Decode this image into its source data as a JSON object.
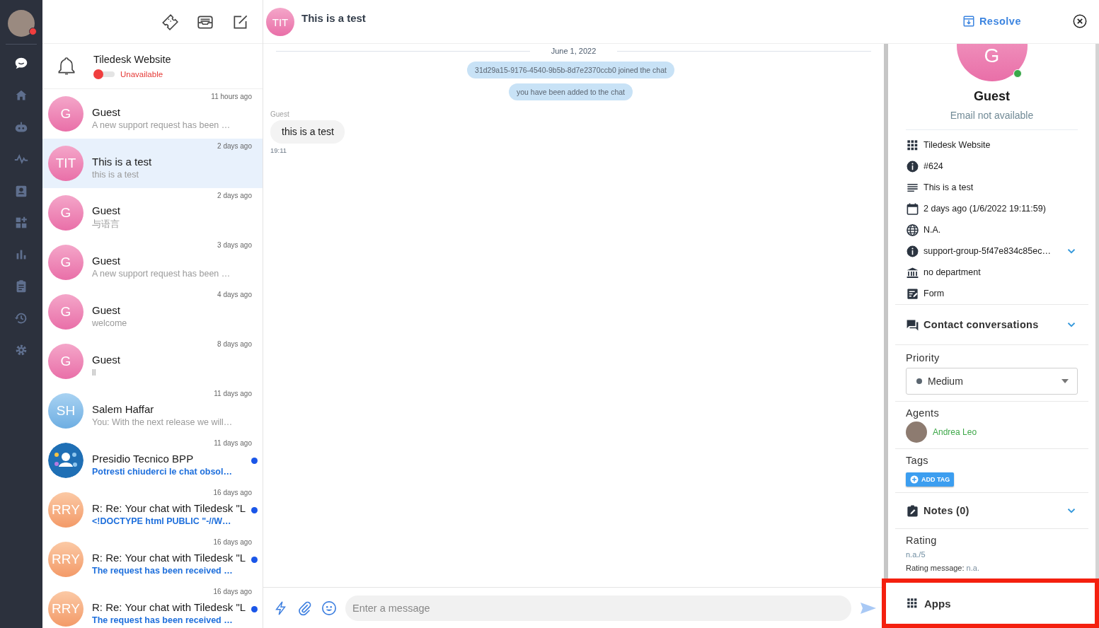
{
  "nav": {
    "items": [
      {
        "kind": "chat",
        "selected": true
      },
      {
        "kind": "home",
        "selected": false
      },
      {
        "kind": "bot",
        "selected": false
      },
      {
        "kind": "activity",
        "selected": false
      },
      {
        "kind": "contacts",
        "selected": false
      },
      {
        "kind": "widgets",
        "selected": false
      },
      {
        "kind": "analytics",
        "selected": false
      },
      {
        "kind": "clipboard",
        "selected": false
      },
      {
        "kind": "history",
        "selected": false
      },
      {
        "kind": "settings",
        "selected": false
      }
    ]
  },
  "availability": {
    "project": "Tiledesk Website",
    "status": "Unavailable",
    "on": false
  },
  "conversations": [
    {
      "kind": "pink",
      "initials": "G",
      "time": "11 hours ago",
      "title": "Guest",
      "preview": "A new support request has been …",
      "unread": false,
      "selected": false
    },
    {
      "kind": "pink",
      "initials": "TIT",
      "time": "2 days ago",
      "title": "This is a test",
      "preview": "this is a test",
      "unread": false,
      "selected": true
    },
    {
      "kind": "pink",
      "initials": "G",
      "time": "2 days ago",
      "title": "Guest",
      "preview": "与语言",
      "unread": false,
      "selected": false
    },
    {
      "kind": "pink",
      "initials": "G",
      "time": "3 days ago",
      "title": "Guest",
      "preview": "A new support request has been …",
      "unread": false,
      "selected": false
    },
    {
      "kind": "pink",
      "initials": "G",
      "time": "4 days ago",
      "title": "Guest",
      "preview": "welcome",
      "unread": false,
      "selected": false
    },
    {
      "kind": "pink",
      "initials": "G",
      "time": "8 days ago",
      "title": "Guest",
      "preview": "ll",
      "unread": false,
      "selected": false
    },
    {
      "kind": "blue",
      "initials": "SH",
      "time": "11 days ago",
      "title": "Salem Haffar",
      "preview": "You: With the next release we will…",
      "unread": false,
      "selected": false
    },
    {
      "kind": "logo",
      "time": "11 days ago",
      "title": "Presidio Tecnico BPP",
      "preview": "Potresti chiuderci le chat obsol…",
      "unread": true,
      "selected": false
    },
    {
      "kind": "orange",
      "initials": "RRY",
      "time": "16 days ago",
      "title": "R: Re: Your chat with Tiledesk \"L",
      "preview": "<!DOCTYPE html PUBLIC \"-//W…",
      "unread": true,
      "selected": false
    },
    {
      "kind": "orange",
      "initials": "RRY",
      "time": "16 days ago",
      "title": "R: Re: Your chat with Tiledesk \"L",
      "preview": "The request has been received …",
      "unread": true,
      "selected": false
    },
    {
      "kind": "orange",
      "initials": "RRY",
      "time": "16 days ago",
      "title": "R: Re: Your chat with Tiledesk \"L",
      "preview": "The request has been received …",
      "unread": true,
      "selected": false
    }
  ],
  "chat": {
    "initials": "TIT",
    "title": "This is a test",
    "resolve": "Resolve",
    "date": "June 1, 2022",
    "messages": [
      {
        "kind": "info",
        "text": "31d29a15-9176-4540-9b5b-8d7e2370ccb0 joined the chat"
      },
      {
        "kind": "info",
        "text": "you have been added to the chat"
      },
      {
        "kind": "incoming",
        "sender": "Guest",
        "text": "this is a test",
        "time": "19:11"
      }
    ],
    "composer": {
      "placeholder": "Enter a message"
    }
  },
  "contact": {
    "initials": "G",
    "name": "Guest",
    "email": "Email not available",
    "online": true,
    "details": [
      {
        "kind": "apps",
        "text": "Tiledesk Website",
        "expandable": false
      },
      {
        "kind": "info",
        "text": "#624",
        "expandable": false
      },
      {
        "kind": "lines",
        "text": "This is a test",
        "expandable": false
      },
      {
        "kind": "calendar",
        "text": "2 days ago (1/6/2022 19:11:59)",
        "expandable": false
      },
      {
        "kind": "globe",
        "text": "N.A.",
        "expandable": false
      },
      {
        "kind": "info",
        "text": "support-group-5f47e834c85ec…",
        "expandable": true
      },
      {
        "kind": "bank",
        "text": "no department",
        "expandable": false
      },
      {
        "kind": "form",
        "text": "Form",
        "expandable": false
      }
    ]
  },
  "contact_conversations": {
    "label": "Contact conversations",
    "expanded": false
  },
  "priority": {
    "label": "Priority",
    "value": "Medium"
  },
  "agents": {
    "label": "Agents",
    "items": [
      {
        "name": "Andrea Leo"
      }
    ]
  },
  "tags": {
    "label": "Tags",
    "add_button": "ADD TAG"
  },
  "notes": {
    "label": "Notes (0)",
    "expanded": false
  },
  "rating": {
    "label": "Rating",
    "score": "n.a./5",
    "message": "**Rating message:** n.a."
  },
  "apps": {
    "label": "Apps",
    "highlighted": true
  }
}
